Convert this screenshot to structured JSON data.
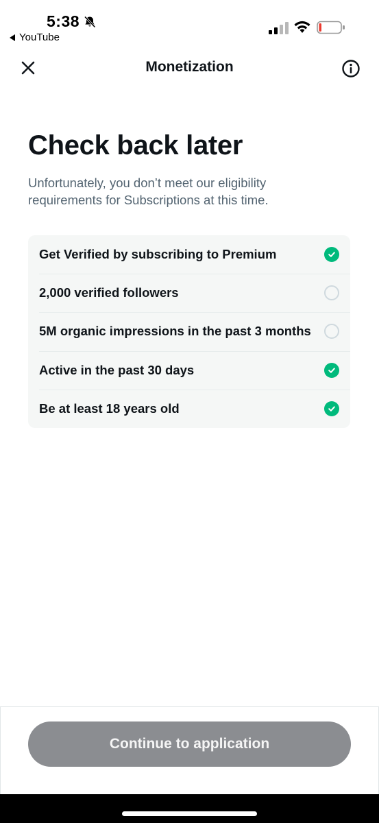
{
  "status_bar": {
    "time": "5:38",
    "back_app": "YouTube",
    "icons": [
      "bell-slash-icon",
      "cellular-signal-icon",
      "wifi-icon",
      "battery-low-icon"
    ]
  },
  "header": {
    "title": "Monetization",
    "close_icon": "close-icon",
    "info_icon": "info-icon"
  },
  "main": {
    "heading": "Check back later",
    "description": "Unfortunately, you don’t meet our eligibility requirements for Subscriptions at this time."
  },
  "requirements": [
    {
      "label": "Get Verified by subscribing to Premium",
      "met": true
    },
    {
      "label": "2,000 verified followers",
      "met": false
    },
    {
      "label": "5M organic impressions in the past 3 months",
      "met": false
    },
    {
      "label": "Active in the past 30 days",
      "met": true
    },
    {
      "label": "Be at least 18 years old",
      "met": true
    }
  ],
  "footer": {
    "continue_label": "Continue to application"
  },
  "colors": {
    "met": "#00ba7c",
    "unmet_border": "#cfd9de",
    "button_disabled": "#8b8d91",
    "secondary_text": "#536471"
  }
}
